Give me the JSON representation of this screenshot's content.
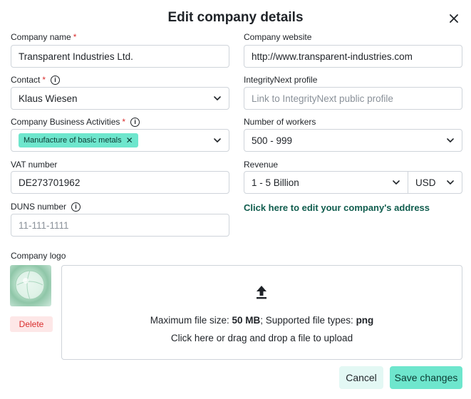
{
  "dialog": {
    "title": "Edit company details"
  },
  "fields": {
    "company_name": {
      "label": "Company name",
      "value": "Transparent Industries Ltd."
    },
    "company_website": {
      "label": "Company website",
      "value": "http://www.transparent-industries.com"
    },
    "contact": {
      "label": "Contact",
      "value": "Klaus Wiesen"
    },
    "integritynext_profile": {
      "label": "IntegrityNext profile",
      "placeholder": "Link to IntegrityNext public profile"
    },
    "business_activities": {
      "label": "Company Business Activities",
      "chip": "Manufacture of basic metals"
    },
    "number_of_workers": {
      "label": "Number of workers",
      "value": "500 - 999"
    },
    "vat_number": {
      "label": "VAT number",
      "value": "DE273701962"
    },
    "revenue": {
      "label": "Revenue",
      "value": "1 - 5 Billion",
      "currency": "USD"
    },
    "duns_number": {
      "label": "DUNS number",
      "placeholder": "11-111-1111"
    }
  },
  "address_link": "Click here to edit your company's address",
  "logo": {
    "label": "Company logo",
    "delete_label": "Delete",
    "dropzone": {
      "size_prefix": "Maximum file size: ",
      "size_value": "50 MB",
      "types_prefix": "; Supported file types: ",
      "types_value": "png",
      "instruction": "Click here or drag and drop a file to upload"
    }
  },
  "actions": {
    "cancel": "Cancel",
    "save": "Save changes"
  },
  "colors": {
    "accent": "#6ee6cd",
    "accent_light": "#e3f8f4",
    "danger": "#d92d2d",
    "link": "#0f5c4d"
  }
}
